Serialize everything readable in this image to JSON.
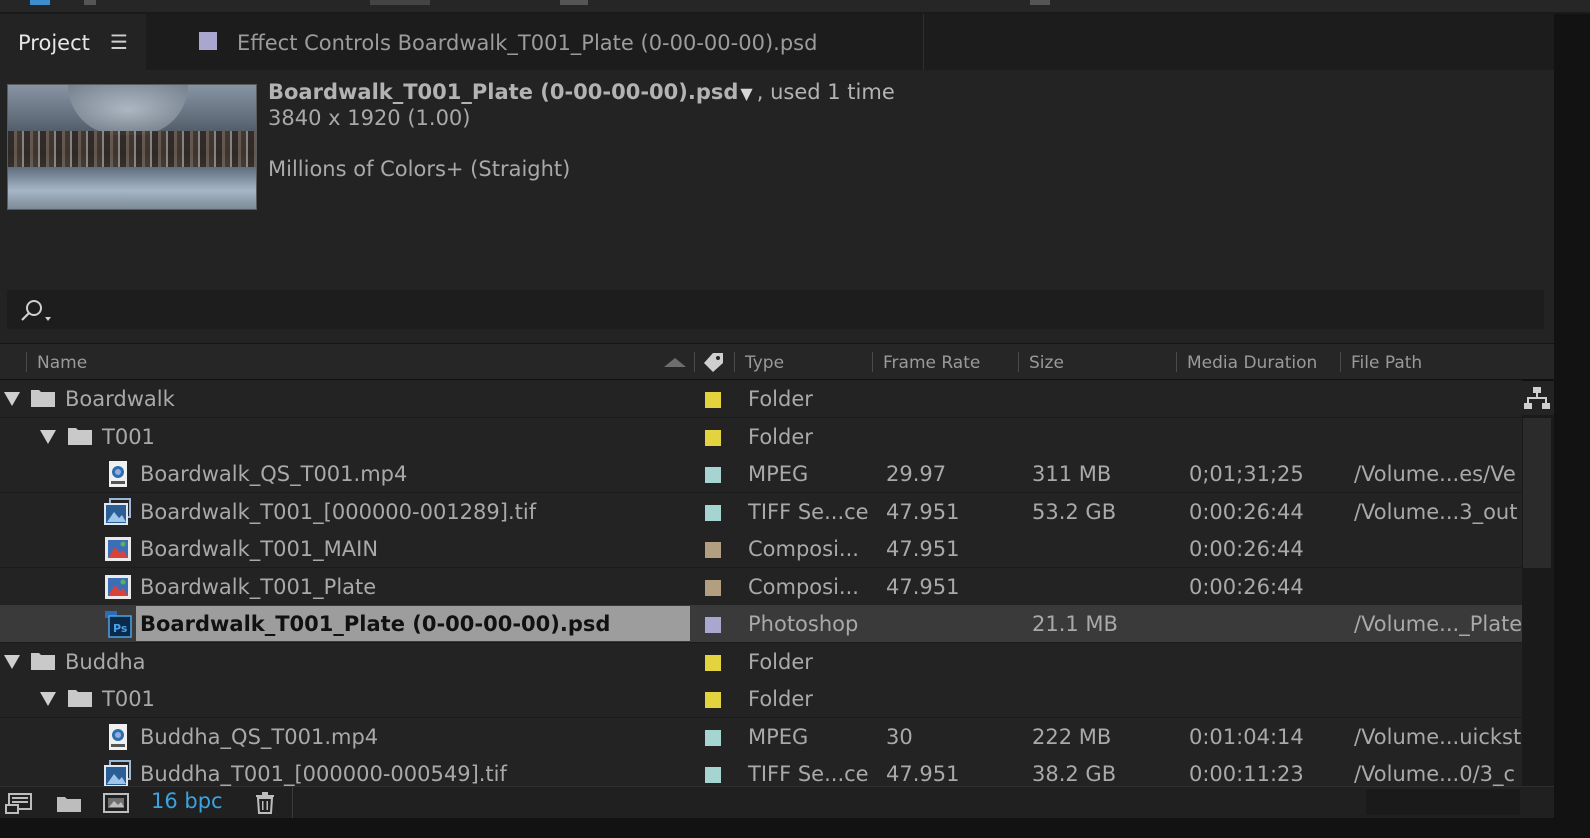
{
  "tabs": {
    "project_label": "Project",
    "project_menu_icon": "hamburger-menu-icon",
    "effect_controls_label": "Effect Controls Boardwalk_T001_Plate (0-00-00-00).psd",
    "effect_controls_swatch": "#a9a6cf"
  },
  "info": {
    "selected_name": "Boardwalk_T001_Plate (0-00-00-00).psd",
    "dropdown_glyph": "▼",
    "used": ", used 1 time",
    "dimensions": "3840 x 1920 (1.00)",
    "colors": "Millions of Colors+ (Straight)"
  },
  "search": {
    "icon": "search-icon",
    "placeholder": ""
  },
  "columns": {
    "name": "Name",
    "label_icon": "tag-icon",
    "type": "Type",
    "frame_rate": "Frame Rate",
    "size": "Size",
    "media_duration": "Media Duration",
    "file_path": "File Path"
  },
  "rows": [
    {
      "kind": "folder",
      "depth": 0,
      "name": "Boardwalk",
      "color": "#e3d43f",
      "type": "Folder",
      "frame_rate": "",
      "size": "",
      "duration": "",
      "path": ""
    },
    {
      "kind": "folder",
      "depth": 1,
      "name": "T001",
      "color": "#e3d43f",
      "type": "Folder",
      "frame_rate": "",
      "size": "",
      "duration": "",
      "path": ""
    },
    {
      "kind": "mpeg",
      "depth": 2,
      "name": "Boardwalk_QS_T001.mp4",
      "color": "#a6d4d1",
      "type": "MPEG",
      "frame_rate": "29.97",
      "size": "311 MB",
      "duration": "0;01;31;25",
      "path": "/Volume...es/Ve"
    },
    {
      "kind": "tiff",
      "depth": 2,
      "name": "Boardwalk_T001_[000000-001289].tif",
      "color": "#a6d4d1",
      "type": "TIFF Se...ce",
      "frame_rate": "47.951",
      "size": "53.2 GB",
      "duration": "0:00:26:44",
      "path": "/Volume...3_out"
    },
    {
      "kind": "comp",
      "depth": 2,
      "name": "Boardwalk_T001_MAIN",
      "color": "#b29f80",
      "type": "Composi...",
      "frame_rate": "47.951",
      "size": "",
      "duration": "0:00:26:44",
      "path": ""
    },
    {
      "kind": "comp",
      "depth": 2,
      "name": "Boardwalk_T001_Plate",
      "color": "#b29f80",
      "type": "Composi...",
      "frame_rate": "47.951",
      "size": "",
      "duration": "0:00:26:44",
      "path": ""
    },
    {
      "kind": "psd",
      "depth": 2,
      "name": "Boardwalk_T001_Plate (0-00-00-00).psd",
      "color": "#a9a6cf",
      "type": "Photoshop",
      "frame_rate": "",
      "size": "21.1 MB",
      "duration": "",
      "path": "/Volume..._Plate",
      "selected": true
    },
    {
      "kind": "folder",
      "depth": 0,
      "name": "Buddha",
      "color": "#e3d43f",
      "type": "Folder",
      "frame_rate": "",
      "size": "",
      "duration": "",
      "path": ""
    },
    {
      "kind": "folder",
      "depth": 1,
      "name": "T001",
      "color": "#e3d43f",
      "type": "Folder",
      "frame_rate": "",
      "size": "",
      "duration": "",
      "path": ""
    },
    {
      "kind": "mpeg",
      "depth": 2,
      "name": "Buddha_QS_T001.mp4",
      "color": "#a6d4d1",
      "type": "MPEG",
      "frame_rate": "30",
      "size": "222 MB",
      "duration": "0:01:04:14",
      "path": "/Volume...uickst"
    },
    {
      "kind": "tiff",
      "depth": 2,
      "name": "Buddha_T001_[000000-000549].tif",
      "color": "#a6d4d1",
      "type": "TIFF Se...ce",
      "frame_rate": "47.951",
      "size": "38.2 GB",
      "duration": "0:00:11:23",
      "path": "/Volume...0/3_c"
    }
  ],
  "bottom": {
    "interpret_icon": "interpret-footage-icon",
    "folder_icon": "new-folder-icon",
    "comp_icon": "new-composition-icon",
    "bpc": "16 bpc",
    "trash_icon": "trash-icon"
  },
  "flowchart_icon": "flowchart-icon"
}
